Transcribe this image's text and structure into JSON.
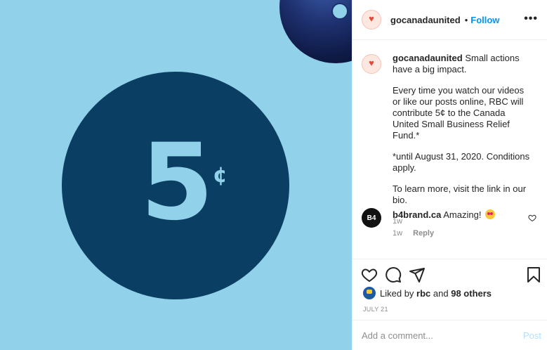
{
  "media": {
    "value": "5",
    "cents": "¢",
    "bg_color": "#92d1ea",
    "circle_color": "#0a3f63"
  },
  "header": {
    "username": "gocanadaunited",
    "separator": "•",
    "follow_label": "Follow",
    "more_icon": "more-options-icon",
    "more_glyph": "•••"
  },
  "caption": {
    "username": "gocanadaunited",
    "paragraphs": [
      "Small actions have a big impact.",
      "Every time you watch our videos or like our posts online, RBC will contribute 5¢ to the Canada United Small Business Relief Fund.*",
      "*until August 31, 2020. Conditions apply.",
      "To learn more, visit the link in our bio."
    ],
    "time": "1w"
  },
  "comment": {
    "avatar_text": "B4",
    "username": "b4brand.ca",
    "text": "Amazing!",
    "time": "1w",
    "reply_label": "Reply"
  },
  "likes": {
    "prefix": "Liked by",
    "user": "rbc",
    "and": "and",
    "others": "98 others"
  },
  "post_date": "JULY 21",
  "comment_box": {
    "placeholder": "Add a comment...",
    "post_label": "Post"
  },
  "colors": {
    "accent": "#0095f6",
    "post_disabled": "#b2dffc"
  }
}
